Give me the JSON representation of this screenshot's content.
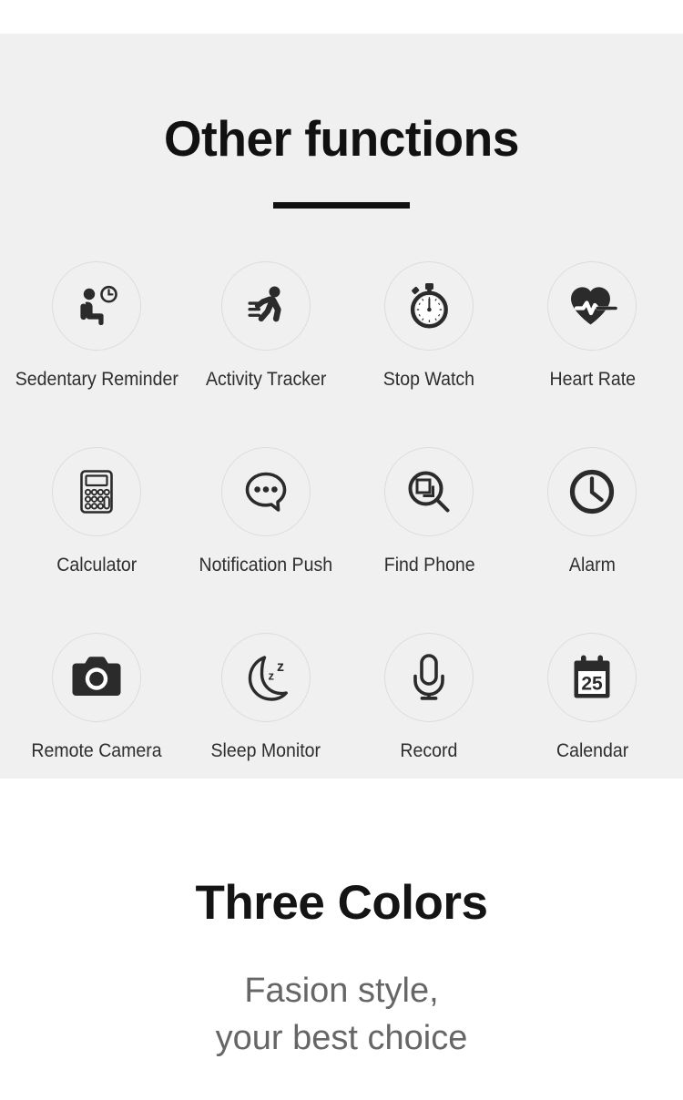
{
  "functions_section": {
    "title": "Other functions",
    "background_color": "#f0f0f0",
    "divider_color": "#111111",
    "circle_ring_color": "#dcdcdc",
    "icon_color": "#2b2b2b",
    "label_color": "#2e2e2e",
    "items": [
      {
        "icon": "sedentary-reminder-icon",
        "label": "Sedentary Reminder"
      },
      {
        "icon": "activity-tracker-icon",
        "label": "Activity Tracker"
      },
      {
        "icon": "stop-watch-icon",
        "label": "Stop Watch"
      },
      {
        "icon": "heart-rate-icon",
        "label": "Heart Rate"
      },
      {
        "icon": "calculator-icon",
        "label": "Calculator"
      },
      {
        "icon": "notification-push-icon",
        "label": "Notification Push"
      },
      {
        "icon": "find-phone-icon",
        "label": "Find Phone"
      },
      {
        "icon": "alarm-icon",
        "label": "Alarm"
      },
      {
        "icon": "remote-camera-icon",
        "label": "Remote Camera"
      },
      {
        "icon": "sleep-monitor-icon",
        "label": "Sleep Monitor"
      },
      {
        "icon": "record-icon",
        "label": "Record"
      },
      {
        "icon": "calendar-icon",
        "label": "Calendar"
      }
    ],
    "calendar_day": "25"
  },
  "colors_section": {
    "background_color": "#ffffff",
    "title": "Three Colors",
    "title_color": "#141414",
    "subtitle_line1": "Fasion style,",
    "subtitle_line2": "your best choice",
    "subtitle_color": "#666666"
  }
}
